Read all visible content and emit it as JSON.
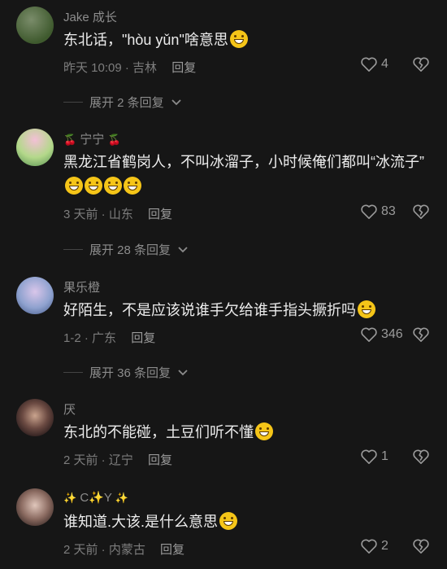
{
  "comments": [
    {
      "username": "Jake 成长",
      "text": "东北话，\"hòu yǔn\"啥意思",
      "emojis": [
        "grin"
      ],
      "time": "昨天 10:09 · 吉林",
      "reply_label": "回复",
      "likes": "4",
      "expand": "展开 2 条回复",
      "avatar_colors": [
        "#3f5a2e",
        "#7a8c6a"
      ]
    },
    {
      "username_prefix": "🍒",
      "username": "宁宁",
      "username_suffix": "🍒",
      "text": "黑龙江省鹤岗人，不叫冰溜子，小时候俺们都叫“冰流子”",
      "emojis": [
        "grin",
        "grin",
        "grin",
        "grin"
      ],
      "time": "3 天前 · 山东",
      "reply_label": "回复",
      "likes": "83",
      "expand": "展开 28 条回复",
      "avatar_colors": [
        "#f3c0d6",
        "#7fb06a"
      ]
    },
    {
      "username": "果乐橙",
      "text": "好陌生，不是应该说谁手欠给谁手指头撅折吗",
      "emojis": [
        "pleading"
      ],
      "time": "1-2 · 广东",
      "reply_label": "回复",
      "likes": "346",
      "expand": "展开 36 条回复",
      "avatar_colors": [
        "#6f86b8",
        "#c7a9d9"
      ]
    },
    {
      "username": "厌",
      "text": "东北的不能碰，土豆们听不懂",
      "emojis": [
        "laugh"
      ],
      "time": "2 天前 · 辽宁",
      "reply_label": "回复",
      "likes": "1",
      "avatar_colors": [
        "#2b1d1d",
        "#caa48e"
      ]
    },
    {
      "username_prefix": "✨",
      "username": "C✨Y",
      "username_suffix": "✨",
      "text": "谁知道.大该.是什么意思",
      "emojis": [
        "grin"
      ],
      "time": "2 天前 · 内蒙古",
      "reply_label": "回复",
      "likes": "2",
      "avatar_colors": [
        "#3b2b28",
        "#e0c6bb"
      ]
    }
  ],
  "icons": {
    "like": "heart-outline-icon",
    "dislike": "broken-heart-icon",
    "expand": "chevron-down-icon"
  }
}
